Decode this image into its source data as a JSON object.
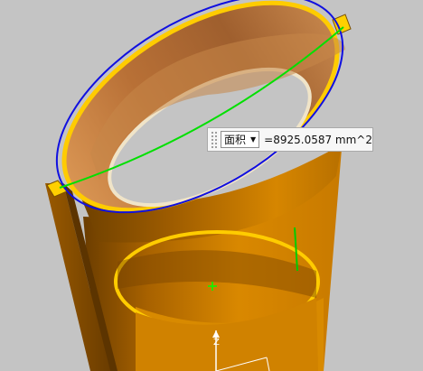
{
  "measurement": {
    "type_selected": "面积",
    "dropdown_arrow": "▼",
    "value_text": "=8925.0587 mm^2"
  },
  "axis": {
    "z_label": "Z"
  },
  "colors": {
    "background": "#c4c4c4",
    "body_orange": "#d88a00",
    "rim_yellow": "#ffcc00",
    "highlight_blue": "#1010e0",
    "measure_line_green": "#00e000"
  },
  "icons": [
    "grip-icon",
    "chevron-down-icon",
    "center-crosshair-icon",
    "axis-triad-icon"
  ]
}
